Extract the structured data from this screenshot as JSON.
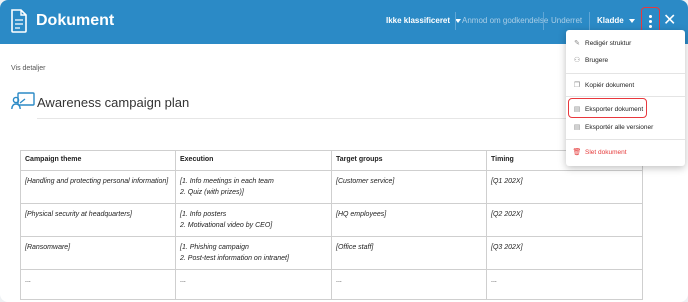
{
  "header": {
    "title": "Dokument",
    "classification": "Ikke klassificeret",
    "request_approval": "Anmod om godkendelse",
    "notified": "Underret",
    "status": "Kladde",
    "close_symbol": "✕",
    "brand_color": "#2b8ac6"
  },
  "details_link": "Vis detaljer",
  "page": {
    "title": "Awareness campaign plan"
  },
  "table": {
    "headers": [
      "Campaign theme",
      "Execution",
      "Target groups",
      "Timing"
    ],
    "rows": [
      [
        "[Handling and protecting personal information]",
        "[1. Info meetings in each team",
        "2. Quiz (with prizes)]",
        "[Customer service]",
        "[Q1 202X]"
      ],
      [
        "[Physical security at headquarters]",
        "[1. Info posters",
        "2. Motivational video by CEO]",
        "[HQ employees]",
        "[Q2 202X]"
      ],
      [
        "[Ransomware]",
        "[1. Phishing campaign",
        "2. Post-test information on intranet]",
        "[Office staff]",
        "[Q3 202X]"
      ],
      [
        "...",
        "...",
        "",
        "...",
        "..."
      ]
    ]
  },
  "menu": {
    "edit_structure": "Redigér struktur",
    "users": "Brugere",
    "copy_document": "Kopiér dokument",
    "export_document": "Eksporter dokument",
    "export_all_versions": "Eksportér alle versioner",
    "delete_document": "Slet dokument",
    "icons": {
      "edit": "pencil-icon",
      "users": "user-icon",
      "copy": "copy-icon",
      "export": "document-icon",
      "export_all": "document-icon",
      "delete": "trash-icon"
    }
  }
}
